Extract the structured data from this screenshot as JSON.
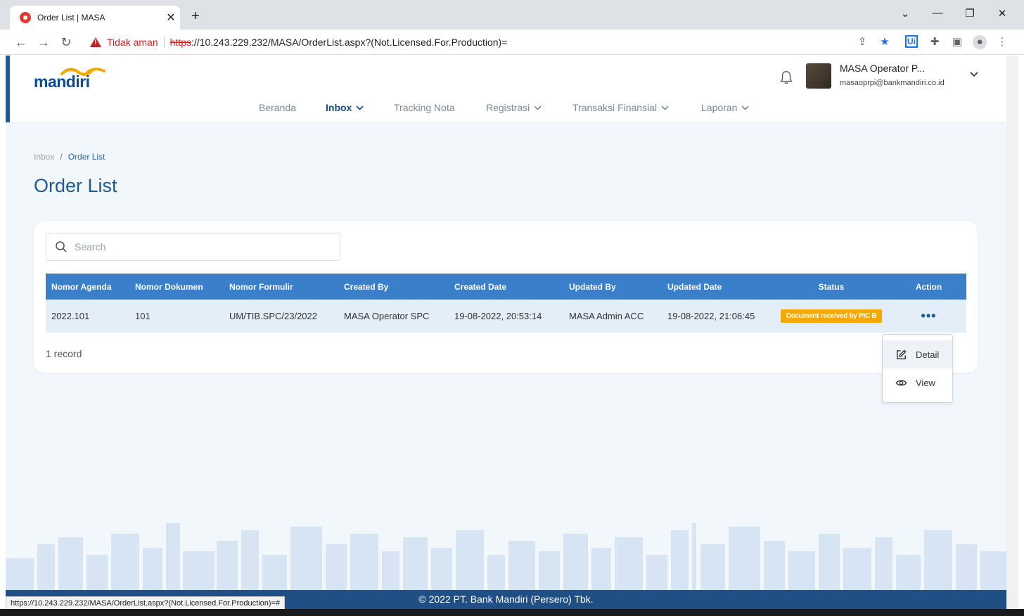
{
  "browser": {
    "tab_title": "Order List | MASA",
    "insecure_label": "Tidak aman",
    "url_scheme": "https",
    "url_rest": "://10.243.229.232/MASA/OrderList.aspx?(Not.Licensed.For.Production)=",
    "status_bar_url": "https://10.243.229.232/MASA/OrderList.aspx?(Not.Licensed.For.Production)=#"
  },
  "header": {
    "logo_text": "mandiri",
    "user_name": "MASA Operator P...",
    "user_email": "masaoprpi@bankmandiri.co.id"
  },
  "menu": {
    "items": [
      {
        "label": "Beranda"
      },
      {
        "label": "Inbox"
      },
      {
        "label": "Tracking Nota"
      },
      {
        "label": "Registrasi"
      },
      {
        "label": "Transaksi Finansial"
      },
      {
        "label": "Laporan"
      }
    ]
  },
  "breadcrumb": {
    "parent": "Inbox",
    "separator": "/",
    "current": "Order List"
  },
  "page": {
    "title": "Order List"
  },
  "search": {
    "placeholder": "Search"
  },
  "table": {
    "headers": [
      "Nomor Agenda",
      "Nomor Dokumen",
      "Nomor Formulir",
      "Created By",
      "Created Date",
      "Updated By",
      "Updated Date",
      "Status",
      "Action"
    ],
    "rows": [
      {
        "nomor_agenda": "2022.101",
        "nomor_dokumen": "101",
        "nomor_formulir": "UM/TIB.SPC/23/2022",
        "created_by": "MASA Operator SPC",
        "created_date": "19-08-2022, 20:53:14",
        "updated_by": "MASA Admin ACC",
        "updated_date": "19-08-2022, 21:06:45",
        "status": "Document received by PIC B",
        "action": "•••"
      }
    ]
  },
  "record_count": "1 record",
  "action_menu": {
    "detail": "Detail",
    "view": "View"
  },
  "footer": {
    "text": "© 2022 PT. Bank Mandiri (Persero) Tbk."
  },
  "colors": {
    "brand": "#1f5a92",
    "table_header": "#3a7fca",
    "status_badge": "#f5a800",
    "footer": "#1f4f84"
  }
}
